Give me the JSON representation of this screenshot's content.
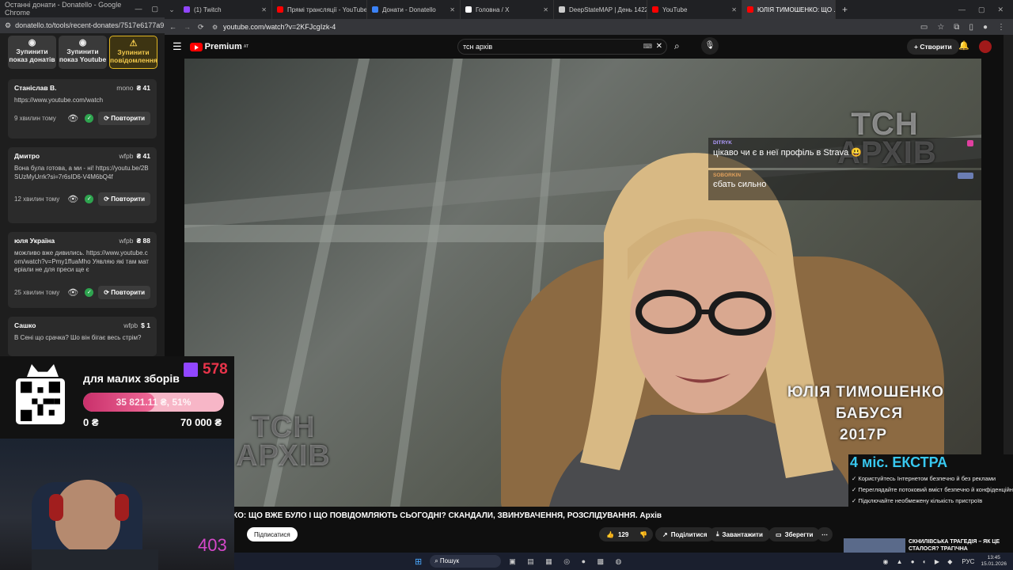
{
  "left_window": {
    "title": "Останні донати - Donatello - Google Chrome",
    "url": "donatello.to/tools/recent-donates/7517e6177a91df3f182...",
    "buttons": [
      "Зупинити показ донатів",
      "Зупинити показ Youtube",
      "Зупинити повідомлення"
    ],
    "donations": [
      {
        "name": "Станіслав В.",
        "method": "mono",
        "amount": "₴ 41",
        "message": "https://www.youtube.com/watch",
        "time": "9 хвилин тому"
      },
      {
        "name": "Дмитро",
        "method": "wfpb",
        "amount": "₴ 41",
        "message": "Вона була готова, а ми - ні! https://youtu.be/2BSUzMyUrrk?si=7r6sID6-V4M6bQ4f",
        "time": "12 хвилин тому"
      },
      {
        "name": "юля Україна",
        "method": "wfpb",
        "amount": "₴ 88",
        "message": "можливо вже дивились. https://www.youtube.com/watch?v=Pmy1ffuaMho Уявляю які там матеріали не для преси ще є",
        "time": "25 хвилин тому"
      },
      {
        "name": "Сашко",
        "method": "wfpb",
        "amount": "$ 1",
        "message": "В Сені що срачка? Шо він бігає весь стрім?",
        "time": ""
      }
    ],
    "repeat_label": "Повторити"
  },
  "tabs": [
    {
      "label": "(1) Twitch",
      "color": "#9146ff"
    },
    {
      "label": "Прямі трансляції - YouTube St...",
      "color": "#ff0000"
    },
    {
      "label": "Донати - Donatello",
      "color": "#3b82f6"
    },
    {
      "label": "Головна / X",
      "color": "#ffffff"
    },
    {
      "label": "DeepStateMAP | День 1422 | М...",
      "color": "#cccccc"
    },
    {
      "label": "YouTube",
      "color": "#ff0000"
    },
    {
      "label": "ЮЛІЯ ТИМОШЕНКО: ЩО ...",
      "color": "#ff0000"
    }
  ],
  "address": "youtube.com/watch?v=2KFJcgIzk-4",
  "youtube": {
    "logo": "Premium",
    "region": "AT",
    "search_value": "тсн архів",
    "create_label": "Створити"
  },
  "chat": [
    {
      "user": "DITRYK",
      "message": "цікаво чи є в неї профіль в Strava 😃",
      "user_color": "#b19cff"
    },
    {
      "user": "SOBORKIN",
      "message": "єбать сильно",
      "user_color": "#e0a05c"
    }
  ],
  "video_overlay": {
    "watermark_top": "ТСН АРХІВ",
    "watermark_bottom": "ТСН АРХІВ",
    "caption_lines": [
      "ЮЛІЯ ТИМОШЕНКО",
      "БАБУСЯ",
      "2017Р"
    ]
  },
  "video_title": "КО: ЩО ВЖЕ БУЛО І ЩО ПОВІДОМЛЯЮТЬ СЬОГОДНІ? СКАНДАЛИ, ЗВИНУВАЧЕННЯ, РОЗСЛІДУВАННЯ. Архів",
  "actions": {
    "subscribe": "Підписатися",
    "likes": "129",
    "share": "Поділитися",
    "download": "Завантажити",
    "save": "Зберегти"
  },
  "donation_widget": {
    "viewers": "578",
    "title": "для малих зборів",
    "progress_label": "35 821.11 ₴, 51%",
    "progress": 0.51,
    "min": "0 ₴",
    "max": "70 000 ₴"
  },
  "webcam": {
    "counter": "403"
  },
  "promo": {
    "title": "4 міс. ЕКСТРА",
    "items": [
      "Користуйтесь Інтернетом безпечно й без реклами",
      "Переглядайте потоковий вміст безпечно й конфіденційно",
      "Підключайте необмежену кількість пристроїв"
    ],
    "news": "СКНИЛІВСЬКА ТРАГЕДІЯ – ЯК ЦЕ СТАЛОСЯ? ТРАГІЧНА"
  },
  "taskbar": {
    "search": "Пошук",
    "lang": "РУС",
    "time": "13:45",
    "date": "15.01.2026"
  }
}
